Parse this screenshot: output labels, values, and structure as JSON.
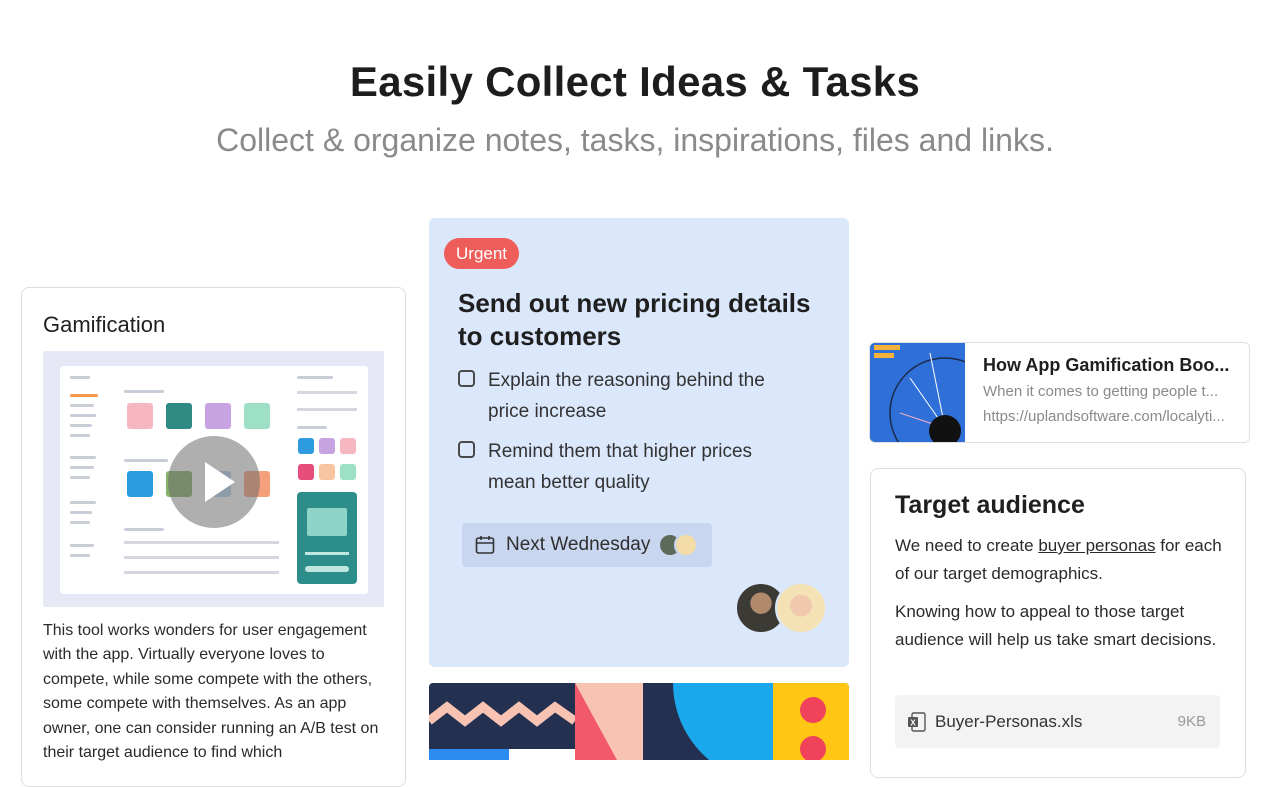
{
  "hero": {
    "title": "Easily Collect Ideas & Tasks",
    "subtitle": "Collect & organize notes, tasks, inspirations, files and links."
  },
  "gamification_card": {
    "title": "Gamification",
    "video_icon": "play-icon",
    "body": "This tool works wonders for user engagement with the app. Virtually everyone loves to compete, while some compete with the others, some compete with themselves. As an app owner, one can consider running an A/B test on their target audience to find which"
  },
  "task_card": {
    "badge": "Urgent",
    "badge_color": "#ef5d5a",
    "background": "#dbe7fb",
    "title": "Send out new pricing details to customers",
    "checklist": [
      {
        "label": "Explain the reasoning behind the price increase",
        "checked": false
      },
      {
        "label": "Remind them that higher prices mean better quality",
        "checked": false
      }
    ],
    "due_icon": "calendar-icon",
    "due_label": "Next Wednesday"
  },
  "link_card": {
    "title": "How App Gamification Boo...",
    "description": "When it comes to getting people t...",
    "url": "https://uplandsoftware.com/localyti..."
  },
  "target_card": {
    "title": "Target audience",
    "p1_before": "We need to create ",
    "p1_link": "buyer personas",
    "p1_after": " for each of our target demographics.",
    "p2": "Knowing how to appeal to those target audience will help us take smart decisions.",
    "file_icon": "excel-file-icon",
    "file_name": "Buyer-Personas.xls",
    "file_size": "9KB"
  }
}
